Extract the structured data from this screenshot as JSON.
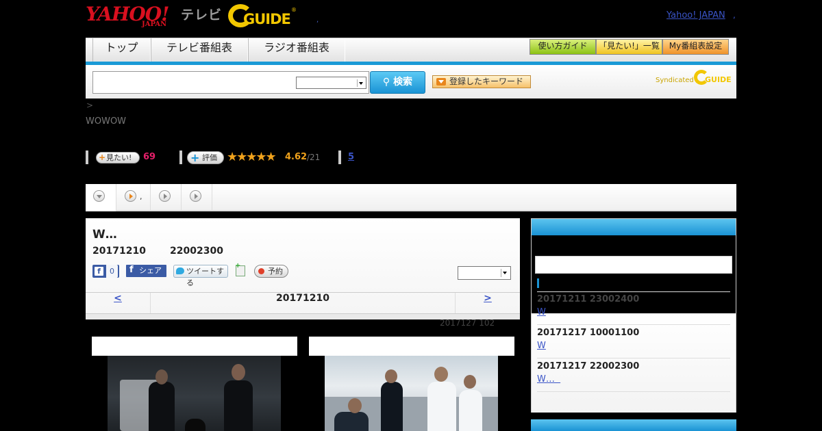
{
  "header": {
    "logo_yahoo_text": "YAHOO!",
    "logo_japan_text": "JAPAN",
    "logo_tv_text": "テレビ",
    "logo_gguide_text": "GUIDE",
    "logo_gguide_reg": "®",
    "separator": ",",
    "yahoo_japan_link": "Yahoo! JAPAN",
    "yahoo_japan_link_trail": ","
  },
  "nav": {
    "tabs": [
      {
        "label": "トップ"
      },
      {
        "label": "テレビ番組表"
      },
      {
        "label": "ラジオ番組表"
      }
    ],
    "buttons": [
      {
        "label": "使い方ガイド",
        "color": "#8cc214"
      },
      {
        "label": "「見たい!」一覧",
        "color": "#f0c420"
      },
      {
        "label": "My番組表設定",
        "color": "#f0932a"
      }
    ],
    "accent_color": "#1a9ad6"
  },
  "search": {
    "input_value": "",
    "select_value": "",
    "button_label": "検索",
    "keyword_button_label": "登録したキーワード",
    "syndicated_text": "Syndicated",
    "syndicated_logo_text": "GUIDE"
  },
  "breadcrumb": ">",
  "channel": "WOWOW",
  "ratings": {
    "mitai_label": "見たい!",
    "mitai_count": "69",
    "hyoka_label": "評価",
    "stars": "★★★★★",
    "score": "4.62",
    "score_count": "/21",
    "reviews_link": "5"
  },
  "subtabs": {
    "second_label": ","
  },
  "program": {
    "title": "W…",
    "date": "20171210",
    "time": "22002300",
    "fb_like_count": "0",
    "fb_share_label": "シェア",
    "tweet_label": "ツイートする",
    "yoyaku_label": "予約",
    "select_value": "",
    "prev_label": "<",
    "center_date": "20171210",
    "next_label": ">",
    "meta_text": "2017127  102"
  },
  "sidebar": {
    "input_value": "",
    "items": [
      {
        "datetime": "20171211  23002400",
        "link": "W"
      },
      {
        "datetime": "20171217  10001100",
        "link": "W"
      },
      {
        "datetime": "20171217  22002300",
        "link": "W…  "
      }
    ]
  }
}
